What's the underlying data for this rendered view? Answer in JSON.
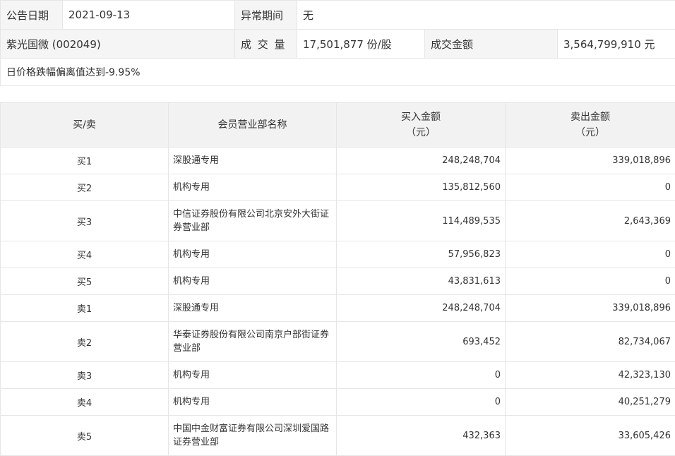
{
  "info": {
    "announce_date_label": "公告日期",
    "announce_date": "2021-09-13",
    "abnormal_period_label": "异常期间",
    "abnormal_period": "无",
    "stock": "紫光国微 (002049)",
    "volume_label": "成 交 量",
    "volume": "17,501,877 份/股",
    "amount_label": "成交金额",
    "amount": "3,564,799,910 元",
    "reason": "日价格跌幅偏离值达到-9.95%"
  },
  "trades": {
    "headers": {
      "side": "买/卖",
      "name": "会员营业部名称",
      "buy_line1": "买入金额",
      "buy_line2": "（元）",
      "sell_line1": "卖出金额",
      "sell_line2": "（元）"
    },
    "rows": [
      {
        "side": "买1",
        "name": "深股通专用",
        "buy": "248,248,704",
        "sell": "339,018,896"
      },
      {
        "side": "买2",
        "name": "机构专用",
        "buy": "135,812,560",
        "sell": "0"
      },
      {
        "side": "买3",
        "name": "中信证券股份有限公司北京安外大街证券营业部",
        "buy": "114,489,535",
        "sell": "2,643,369"
      },
      {
        "side": "买4",
        "name": "机构专用",
        "buy": "57,956,823",
        "sell": "0"
      },
      {
        "side": "买5",
        "name": "机构专用",
        "buy": "43,831,613",
        "sell": "0"
      },
      {
        "side": "卖1",
        "name": "深股通专用",
        "buy": "248,248,704",
        "sell": "339,018,896"
      },
      {
        "side": "卖2",
        "name": "华泰证券股份有限公司南京户部街证券营业部",
        "buy": "693,452",
        "sell": "82,734,067"
      },
      {
        "side": "卖3",
        "name": "机构专用",
        "buy": "0",
        "sell": "42,323,130"
      },
      {
        "side": "卖4",
        "name": "机构专用",
        "buy": "0",
        "sell": "40,251,279"
      },
      {
        "side": "卖5",
        "name": "中国中金财富证券有限公司深圳爱国路证券营业部",
        "buy": "432,363",
        "sell": "33,605,426"
      }
    ]
  }
}
